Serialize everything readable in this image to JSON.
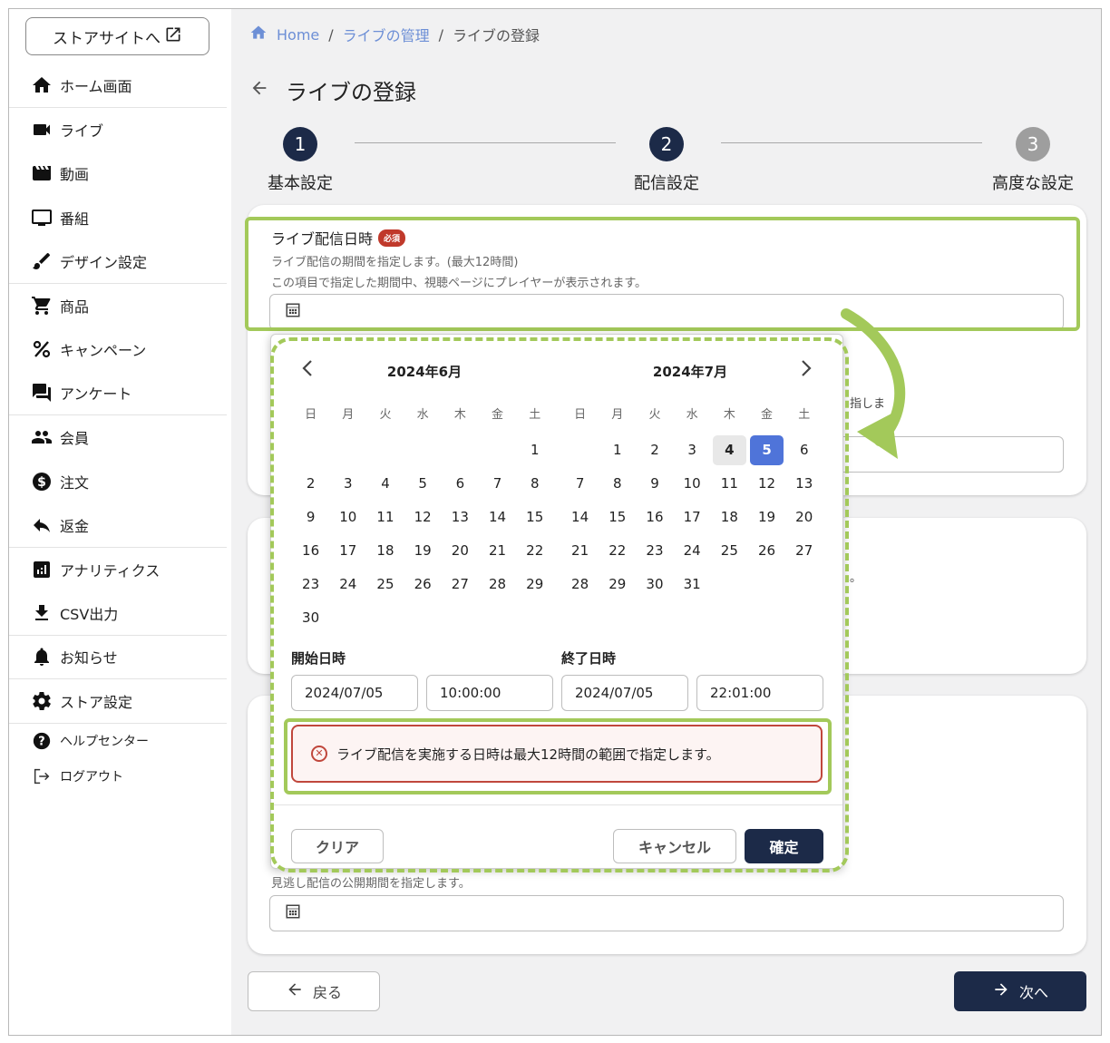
{
  "sidebar": {
    "store_button": "ストアサイトへ",
    "items": [
      {
        "label": "ホーム画面",
        "icon": "home-icon"
      },
      {
        "label": "ライブ",
        "icon": "video-camera-icon"
      },
      {
        "label": "動画",
        "icon": "clapperboard-icon"
      },
      {
        "label": "番組",
        "icon": "monitor-icon"
      },
      {
        "label": "デザイン設定",
        "icon": "brush-icon"
      },
      {
        "label": "商品",
        "icon": "cart-icon"
      },
      {
        "label": "キャンペーン",
        "icon": "percent-icon"
      },
      {
        "label": "アンケート",
        "icon": "chat-bubbles-icon"
      },
      {
        "label": "会員",
        "icon": "people-icon"
      },
      {
        "label": "注文",
        "icon": "dollar-icon"
      },
      {
        "label": "返金",
        "icon": "reply-icon"
      },
      {
        "label": "アナリティクス",
        "icon": "analytics-icon"
      },
      {
        "label": "CSV出力",
        "icon": "download-icon"
      },
      {
        "label": "お知らせ",
        "icon": "bell-icon"
      },
      {
        "label": "ストア設定",
        "icon": "gear-icon"
      },
      {
        "label": "ヘルプセンター",
        "icon": "help-icon"
      },
      {
        "label": "ログアウト",
        "icon": "logout-icon"
      }
    ]
  },
  "breadcrumb": {
    "home": "Home",
    "sep": "/",
    "live_manage": "ライブの管理",
    "current": "ライブの登録"
  },
  "page_title": "ライブの登録",
  "steps": [
    {
      "num": "1",
      "label": "基本設定"
    },
    {
      "num": "2",
      "label": "配信設定"
    },
    {
      "num": "3",
      "label": "高度な設定"
    }
  ],
  "field": {
    "label": "ライブ配信日時",
    "required": "必須",
    "hint1": "ライブ配信の期間を指定します。(最大12時間)",
    "hint2": "この項目で指定した期間中、視聴ページにプレイヤーが表示されます。"
  },
  "peek": {
    "text1": "指しま",
    "text2": "。"
  },
  "archive_hint": "見逃し配信の公開期間を指定します。",
  "calendar": {
    "left_month": "2024年6月",
    "right_month": "2024年7月",
    "dow": [
      "日",
      "月",
      "火",
      "水",
      "木",
      "金",
      "土"
    ],
    "june": [
      "",
      "",
      "",
      "",
      "",
      "",
      "1",
      "2",
      "3",
      "4",
      "5",
      "6",
      "7",
      "8",
      "9",
      "10",
      "11",
      "12",
      "13",
      "14",
      "15",
      "16",
      "17",
      "18",
      "19",
      "20",
      "21",
      "22",
      "23",
      "24",
      "25",
      "26",
      "27",
      "28",
      "29",
      "30"
    ],
    "july": [
      "",
      "1",
      "2",
      "3",
      "4",
      "5",
      "6",
      "7",
      "8",
      "9",
      "10",
      "11",
      "12",
      "13",
      "14",
      "15",
      "16",
      "17",
      "18",
      "19",
      "20",
      "21",
      "22",
      "23",
      "24",
      "25",
      "26",
      "27",
      "28",
      "29",
      "30",
      "31"
    ],
    "today": "4",
    "selected": "5",
    "start_label": "開始日時",
    "end_label": "終了日時",
    "start_date": "2024/07/05",
    "start_time": "10:00:00",
    "end_date": "2024/07/05",
    "end_time": "22:01:00",
    "error": "ライブ配信を実施する日時は最大12時間の範囲で指定します。",
    "clear": "クリア",
    "cancel": "キャンセル",
    "confirm": "確定"
  },
  "footer": {
    "back": "戻る",
    "next": "次へ"
  },
  "colors": {
    "accent": "#1c2a48",
    "highlight": "#a3c95a",
    "selected": "#4f74d9",
    "error": "#c0473c",
    "link": "#6d8fd6"
  }
}
